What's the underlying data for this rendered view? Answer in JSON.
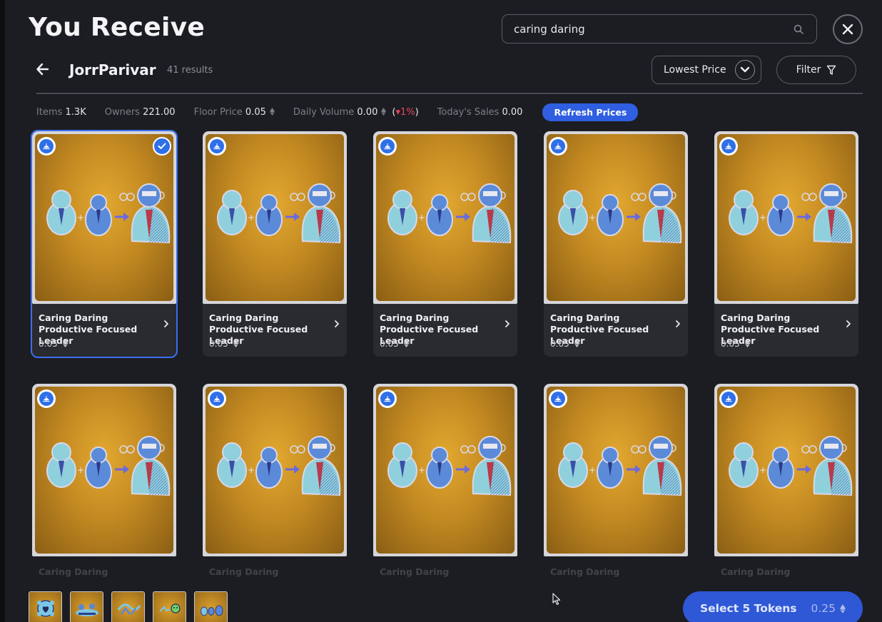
{
  "header": {
    "title": "You Receive",
    "search_value": "caring daring",
    "close_label": "close"
  },
  "collection": {
    "name": "JorrParivar",
    "results": "41 results"
  },
  "controls": {
    "sort_label": "Lowest Price",
    "filter_label": "Filter"
  },
  "stats": {
    "items_label": "Items",
    "items_value": "1.3K",
    "owners_label": "Owners",
    "owners_value": "221.00",
    "floor_label": "Floor Price",
    "floor_value": "0.05",
    "volume_label": "Daily Volume",
    "volume_value": "0.00",
    "volume_change": "1%",
    "sales_label": "Today's Sales",
    "sales_value": "0.00",
    "refresh_label": "Refresh Prices"
  },
  "cards": [
    {
      "title": "Caring Daring Productive Focused Leader",
      "price": "0.05",
      "selected": true
    },
    {
      "title": "Caring Daring Productive Focused Leader",
      "price": "0.05",
      "selected": false
    },
    {
      "title": "Caring Daring Productive Focused Leader",
      "price": "0.05",
      "selected": false
    },
    {
      "title": "Caring Daring Productive Focused Leader",
      "price": "0.05",
      "selected": false
    },
    {
      "title": "Caring Daring Productive Focused Leader",
      "price": "0.05",
      "selected": false
    },
    {
      "title": "Caring Daring Productive",
      "price": "",
      "selected": false
    },
    {
      "title": "Caring Daring Productive",
      "price": "",
      "selected": false
    },
    {
      "title": "Caring Daring Productive",
      "price": "",
      "selected": false
    },
    {
      "title": "Caring Daring Productive",
      "price": "",
      "selected": false
    },
    {
      "title": "Caring Daring Productive",
      "price": "",
      "selected": false
    }
  ],
  "footer": {
    "select_label": "Select 5 Tokens",
    "select_total": "0.25"
  },
  "colors": {
    "accent": "#2f6fe8",
    "negative": "#e5465e",
    "background": "#1c1d22"
  }
}
